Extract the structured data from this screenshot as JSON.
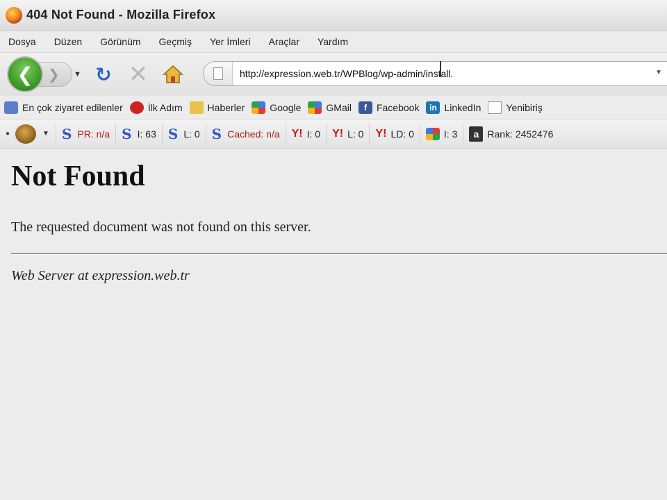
{
  "window": {
    "title": "404 Not Found - Mozilla Firefox"
  },
  "menu": [
    "Dosya",
    "Düzen",
    "Görünüm",
    "Geçmiş",
    "Yer İmleri",
    "Araçlar",
    "Yardım"
  ],
  "nav": {
    "url": "http://expression.web.tr/WPBlog/wp-admin/install.",
    "back_icon": "back-arrow-icon",
    "forward_icon": "forward-arrow-icon",
    "reload_icon": "reload-icon",
    "stop_icon": "stop-icon",
    "home_icon": "home-icon"
  },
  "bookmarks": [
    {
      "label": "En çok ziyaret edilenler",
      "icon": "most-visited-icon"
    },
    {
      "label": "İlk Adım",
      "icon": "first-steps-icon"
    },
    {
      "label": "Haberler",
      "icon": "rss-folder-icon"
    },
    {
      "label": "Google",
      "icon": "google-icon"
    },
    {
      "label": "GMail",
      "icon": "gmail-icon"
    },
    {
      "label": "Facebook",
      "icon": "facebook-icon"
    },
    {
      "label": "LinkedIn",
      "icon": "linkedin-icon"
    },
    {
      "label": "Yenibiriş",
      "icon": "page-icon"
    }
  ],
  "seo_toolbar": {
    "items": [
      {
        "label": "PR: n/a",
        "icon": "google-s-icon",
        "style": "red"
      },
      {
        "label": "I: 63",
        "icon": "google-s-icon",
        "style": "dark"
      },
      {
        "label": "L: 0",
        "icon": "google-s-icon",
        "style": "dark"
      },
      {
        "label": "Cached: n/a",
        "icon": "google-s-icon",
        "style": "red"
      },
      {
        "label": "I: 0",
        "icon": "yahoo-y-icon",
        "style": "dark"
      },
      {
        "label": "L: 0",
        "icon": "yahoo-y-icon",
        "style": "dark"
      },
      {
        "label": "LD: 0",
        "icon": "yahoo-y-icon",
        "style": "dark"
      },
      {
        "label": "I: 3",
        "icon": "msn-icon",
        "style": "dark"
      },
      {
        "label": "Rank: 2452476",
        "icon": "alexa-rank-icon",
        "style": "dark"
      }
    ]
  },
  "page": {
    "heading": "Not Found",
    "message": "The requested document was not found on this server.",
    "address": "Web Server at expression.web.tr"
  },
  "colors": {
    "link_red": "#b01a1a",
    "reload_blue": "#2a66c4",
    "back_green": "#3f9a2a"
  }
}
